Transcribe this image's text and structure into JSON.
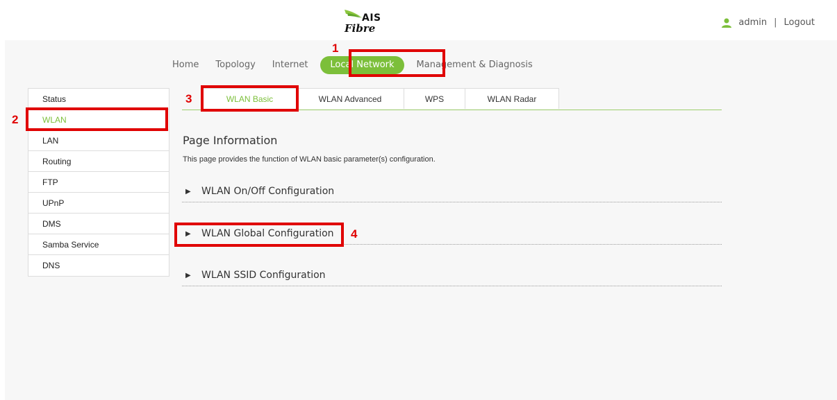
{
  "header": {
    "logo_top": "AIS",
    "logo_bottom": "Fibre",
    "user_name": "admin",
    "separator": "|",
    "logout_label": "Logout"
  },
  "main_nav": {
    "items": [
      {
        "label": "Home"
      },
      {
        "label": "Topology"
      },
      {
        "label": "Internet"
      },
      {
        "label": "Local Network",
        "active": true
      },
      {
        "label": "Management & Diagnosis"
      }
    ]
  },
  "sidebar": {
    "items": [
      {
        "label": "Status"
      },
      {
        "label": "WLAN",
        "active": true
      },
      {
        "label": "LAN"
      },
      {
        "label": "Routing"
      },
      {
        "label": "FTP"
      },
      {
        "label": "UPnP"
      },
      {
        "label": "DMS"
      },
      {
        "label": "Samba Service"
      },
      {
        "label": "DNS"
      }
    ]
  },
  "tabs": [
    {
      "label": "WLAN Basic",
      "active": true
    },
    {
      "label": "WLAN Advanced"
    },
    {
      "label": "WPS"
    },
    {
      "label": "WLAN Radar"
    }
  ],
  "page_info": {
    "title": "Page Information",
    "description": "This page provides the function of WLAN basic parameter(s) configuration."
  },
  "sections": [
    {
      "label": "WLAN On/Off Configuration"
    },
    {
      "label": "WLAN Global Configuration"
    },
    {
      "label": "WLAN SSID Configuration"
    }
  ],
  "annotations": [
    "1",
    "2",
    "3",
    "4"
  ],
  "colors": {
    "accent": "#7cbf3a",
    "highlight": "#e00000"
  },
  "icons": {
    "user": "user-icon",
    "logo": "ais-swoosh-logo",
    "expand": "triangle-right-icon"
  }
}
